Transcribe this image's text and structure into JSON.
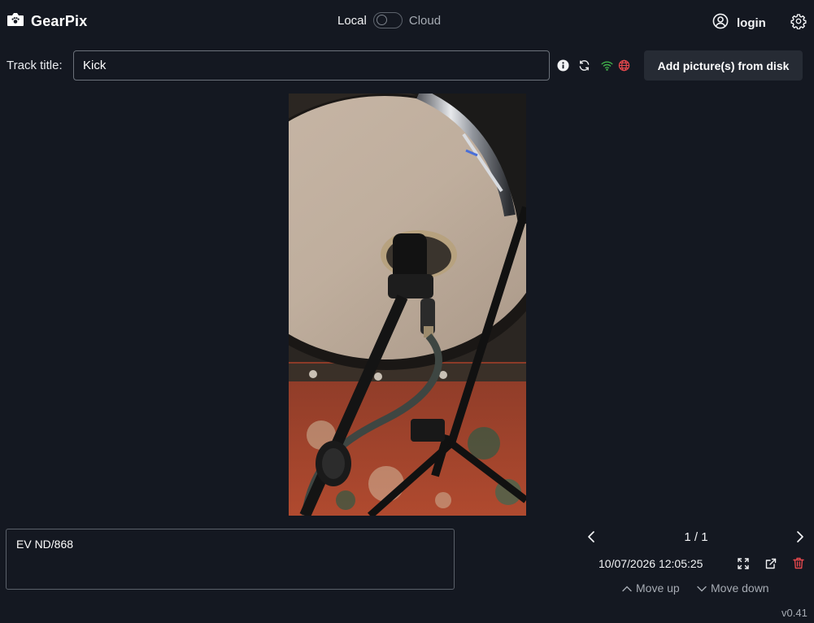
{
  "app": {
    "title": "GearPix",
    "icon": "camera-paw-icon"
  },
  "mode": {
    "local_label": "Local",
    "cloud_label": "Cloud",
    "cloud_enabled": false
  },
  "auth": {
    "login_label": "login",
    "icon": "user-circle-icon"
  },
  "settings_icon": "gear-icon",
  "track": {
    "label": "Track title:",
    "value": "Kick",
    "icons": [
      "info-icon",
      "refresh-icon",
      "wifi-icon",
      "globe-icon"
    ],
    "wifi_color": "#3fae49",
    "globe_color": "#e5484d"
  },
  "add_pictures_label": "Add picture(s) from disk",
  "photo": {
    "description_icon": "photo-image"
  },
  "notes": {
    "value": "EV ND/868"
  },
  "pager": {
    "count": "1 / 1",
    "timestamp": "10/07/2026 12:05:25",
    "move_up_label": "Move up",
    "move_down_label": "Move down",
    "delete_color": "#e5484d"
  },
  "version": "v0.41"
}
